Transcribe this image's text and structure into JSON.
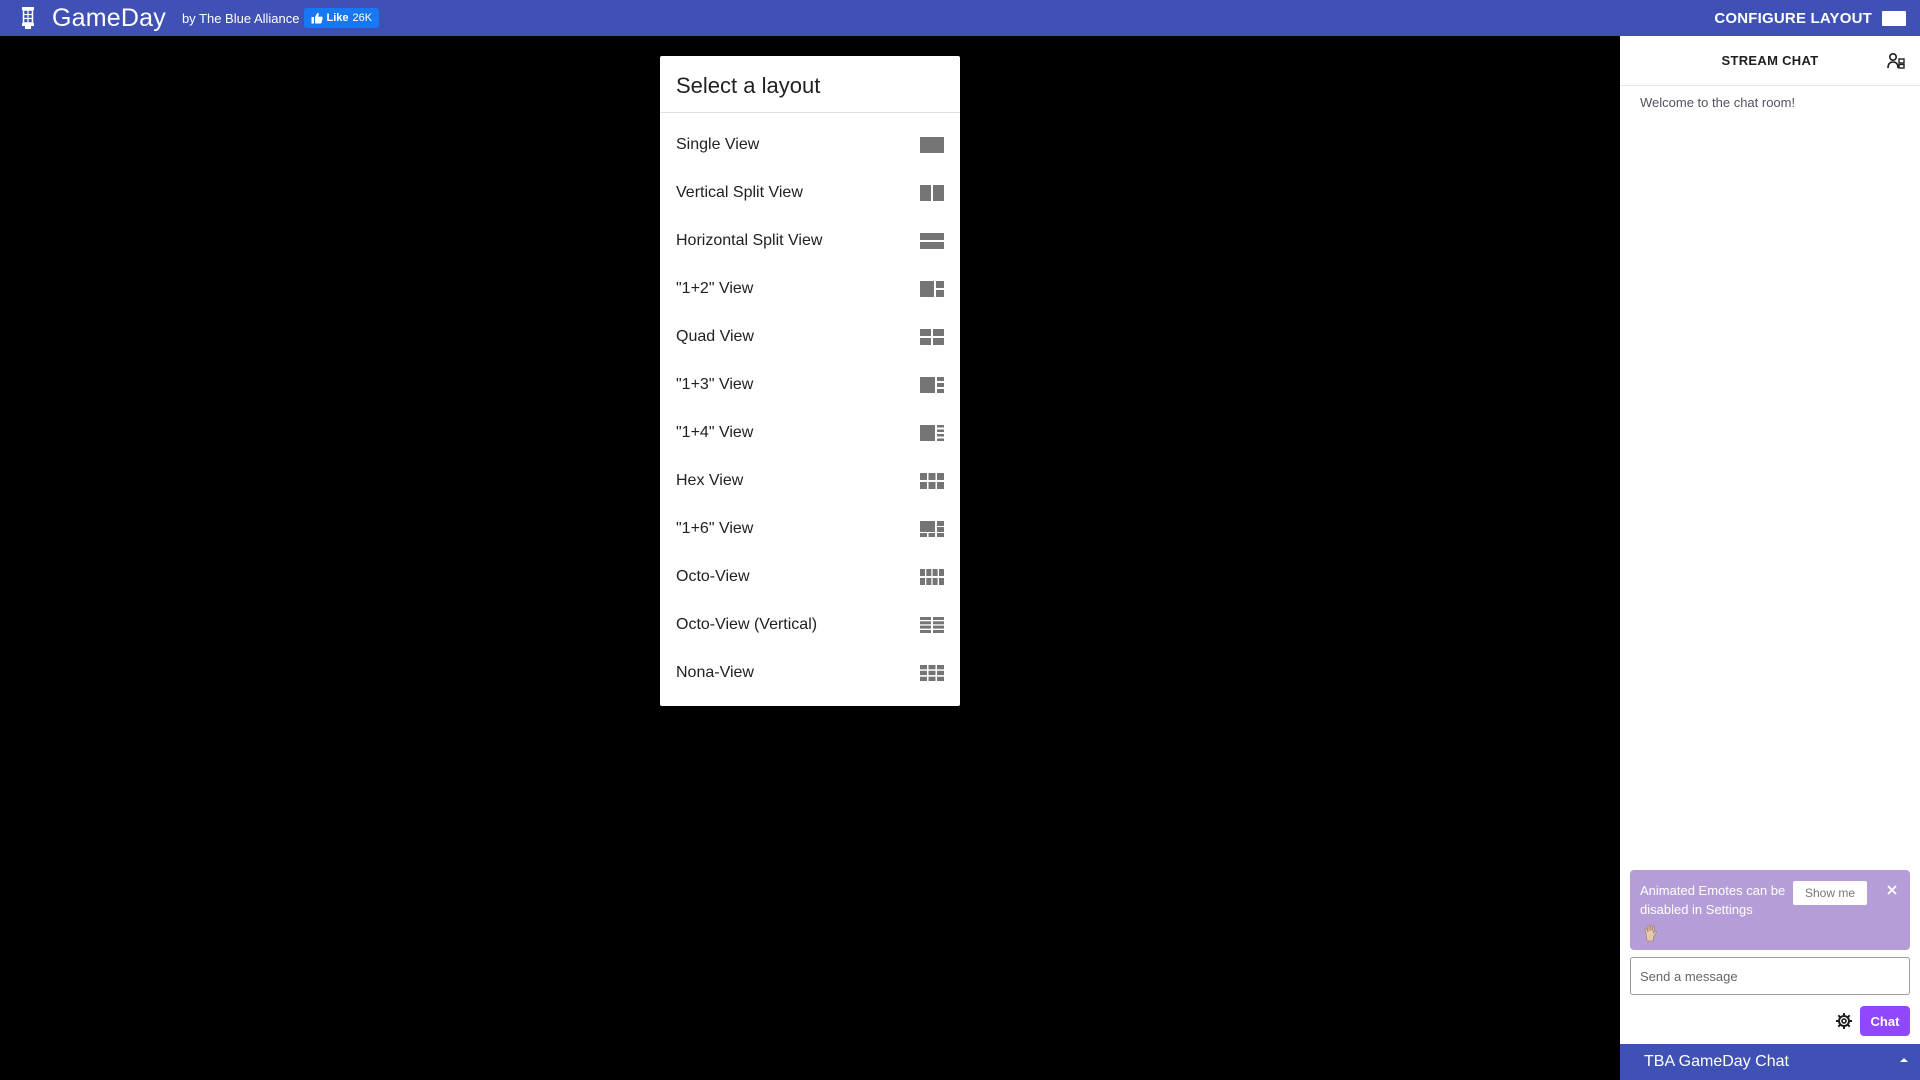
{
  "app": {
    "title": "GameDay",
    "byline": "by The Blue Alliance",
    "facebook_like": {
      "label": "Like",
      "count": "26K"
    },
    "configure_label": "CONFIGURE LAYOUT"
  },
  "layout_dialog": {
    "title": "Select a layout",
    "items": [
      {
        "label": "Single View",
        "icon": "layout-single-icon"
      },
      {
        "label": "Vertical Split View",
        "icon": "layout-vertical-split-icon"
      },
      {
        "label": "Horizontal Split View",
        "icon": "layout-horizontal-split-icon"
      },
      {
        "label": "\"1+2\" View",
        "icon": "layout-1-plus-2-icon"
      },
      {
        "label": "Quad View",
        "icon": "layout-quad-icon"
      },
      {
        "label": "\"1+3\" View",
        "icon": "layout-1-plus-3-icon"
      },
      {
        "label": "\"1+4\" View",
        "icon": "layout-1-plus-4-icon"
      },
      {
        "label": "Hex View",
        "icon": "layout-hex-icon"
      },
      {
        "label": "\"1+6\" View",
        "icon": "layout-1-plus-6-icon"
      },
      {
        "label": "Octo-View",
        "icon": "layout-octo-icon"
      },
      {
        "label": "Octo-View (Vertical)",
        "icon": "layout-octo-vertical-icon"
      },
      {
        "label": "Nona-View",
        "icon": "layout-nona-icon"
      }
    ]
  },
  "chat": {
    "header": "STREAM CHAT",
    "welcome": "Welcome to the chat room!",
    "notice": {
      "text": "Animated Emotes can be disabled in Settings",
      "show_me": "Show me"
    },
    "input_placeholder": "Send a message",
    "send_label": "Chat",
    "footer": "TBA GameDay Chat"
  },
  "colors": {
    "appbar": "#3f51b5",
    "layout_icon": "#757575",
    "chat_button": "#9147ff",
    "notice_bg": "#b59ed8"
  }
}
